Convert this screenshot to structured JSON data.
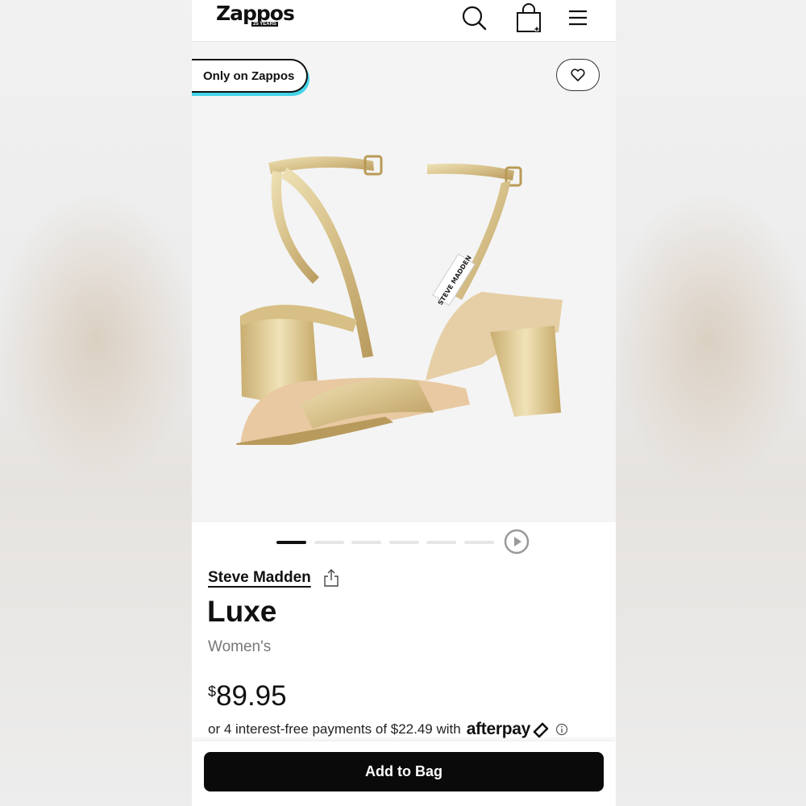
{
  "header": {
    "logo_text": "Zappos",
    "logo_sub": "25 YEARS",
    "icons": [
      "search-icon",
      "shopping-bag-icon",
      "menu-icon"
    ]
  },
  "gallery": {
    "badge_label": "Only on Zappos",
    "shoe_label_text": "STEVE MADDEN",
    "image_count": 6,
    "active_image_index": 0
  },
  "product": {
    "brand": "Steve Madden",
    "name": "Luxe",
    "gender": "Women's",
    "price_currency": "$",
    "price_amount": "89.95",
    "afterpay_text": "or 4 interest-free payments of $22.49 with",
    "afterpay_logo": "afterpay"
  },
  "cta": {
    "add_to_bag_label": "Add to Bag"
  },
  "colors": {
    "accent_cyan": "#44d3e8",
    "cta_bg": "#0a0a0a",
    "gallery_bg": "#f4f4f4",
    "shoe_gold": "#d9c48f"
  }
}
